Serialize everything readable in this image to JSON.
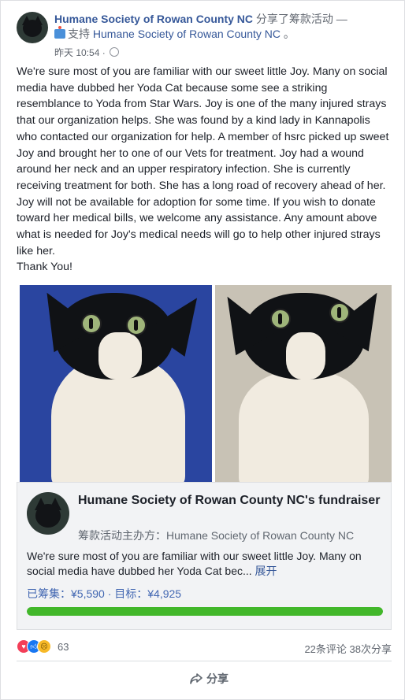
{
  "header": {
    "page_name": "Humane Society of Rowan County NC",
    "action_text": "分享了筹款活动 —",
    "support_prefix": "支持",
    "support_page": "Humane Society of Rowan County NC",
    "support_suffix": "。",
    "timestamp": "昨天 10:54",
    "dot": "·"
  },
  "post": {
    "text": "We're sure most of you are familiar with our sweet little Joy. Many on social media have dubbed her Yoda Cat because some see a striking resemblance to Yoda from Star Wars. Joy is one of the many injured strays that our organization helps. She was found by a kind lady in Kannapolis who contacted our organization for help. A member of hsrc picked up sweet Joy and brought her to one of our Vets for treatment. Joy had a wound around her neck and an upper respiratory infection. She is currently receiving treatment for both. She has a long road of recovery ahead of her. Joy will not be available for adoption for some time. If you wish to donate toward her medical bills, we welcome any assistance. Any amount above what is needed for Joy's medical needs will go to help other injured strays like her.",
    "signoff": "Thank You!"
  },
  "fundraiser": {
    "title": "Humane Society of Rowan County NC's fundraiser",
    "organizer": "筹款活动主办方：Humane Society of Rowan County NC",
    "description": "We're sure most of you are familiar with our sweet little Joy. Many on social media have dubbed her Yoda Cat bec...",
    "expand_label": "展开",
    "raised_text": "已筹集：¥5,590 · 目标：¥4,925",
    "progress_fraction": 1.0,
    "progress_color": "#42b72a"
  },
  "reactions": {
    "count": "63",
    "comments": "22条评论",
    "shares": "38次分享"
  },
  "actions": {
    "share_label": "分享"
  },
  "colors": {
    "link": "#365899",
    "accent": "#4267b2"
  },
  "icons": [
    "globe-icon",
    "gift-icon",
    "love-reaction-icon",
    "like-reaction-icon",
    "sad-reaction-icon",
    "share-icon"
  ]
}
